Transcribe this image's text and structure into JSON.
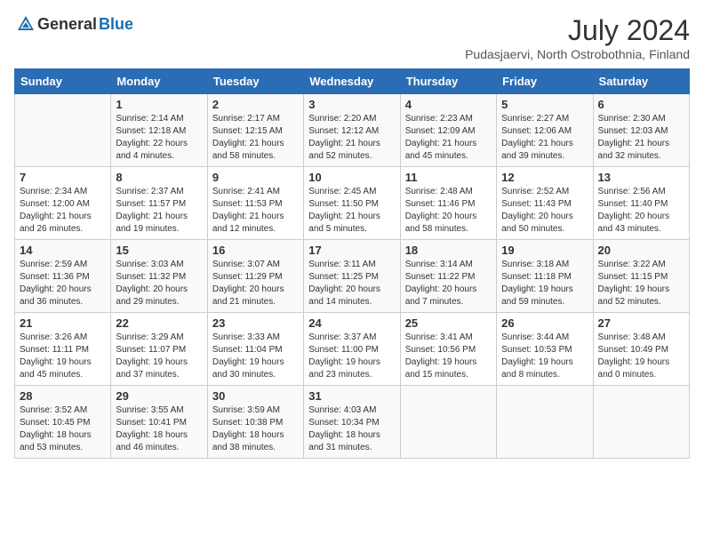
{
  "header": {
    "logo_general": "General",
    "logo_blue": "Blue",
    "month_year": "July 2024",
    "location": "Pudasjaervi, North Ostrobothnia, Finland"
  },
  "days_of_week": [
    "Sunday",
    "Monday",
    "Tuesday",
    "Wednesday",
    "Thursday",
    "Friday",
    "Saturday"
  ],
  "weeks": [
    [
      {
        "day": "",
        "detail": ""
      },
      {
        "day": "1",
        "detail": "Sunrise: 2:14 AM\nSunset: 12:18 AM\nDaylight: 22 hours and 4 minutes."
      },
      {
        "day": "2",
        "detail": "Sunrise: 2:17 AM\nSunset: 12:15 AM\nDaylight: 21 hours and 58 minutes."
      },
      {
        "day": "3",
        "detail": "Sunrise: 2:20 AM\nSunset: 12:12 AM\nDaylight: 21 hours and 52 minutes."
      },
      {
        "day": "4",
        "detail": "Sunrise: 2:23 AM\nSunset: 12:09 AM\nDaylight: 21 hours and 45 minutes."
      },
      {
        "day": "5",
        "detail": "Sunrise: 2:27 AM\nSunset: 12:06 AM\nDaylight: 21 hours and 39 minutes."
      },
      {
        "day": "6",
        "detail": "Sunrise: 2:30 AM\nSunset: 12:03 AM\nDaylight: 21 hours and 32 minutes."
      }
    ],
    [
      {
        "day": "7",
        "detail": "Sunrise: 2:34 AM\nSunset: 12:00 AM\nDaylight: 21 hours and 26 minutes."
      },
      {
        "day": "8",
        "detail": "Sunrise: 2:37 AM\nSunset: 11:57 PM\nDaylight: 21 hours and 19 minutes."
      },
      {
        "day": "9",
        "detail": "Sunrise: 2:41 AM\nSunset: 11:53 PM\nDaylight: 21 hours and 12 minutes."
      },
      {
        "day": "10",
        "detail": "Sunrise: 2:45 AM\nSunset: 11:50 PM\nDaylight: 21 hours and 5 minutes."
      },
      {
        "day": "11",
        "detail": "Sunrise: 2:48 AM\nSunset: 11:46 PM\nDaylight: 20 hours and 58 minutes."
      },
      {
        "day": "12",
        "detail": "Sunrise: 2:52 AM\nSunset: 11:43 PM\nDaylight: 20 hours and 50 minutes."
      },
      {
        "day": "13",
        "detail": "Sunrise: 2:56 AM\nSunset: 11:40 PM\nDaylight: 20 hours and 43 minutes."
      }
    ],
    [
      {
        "day": "14",
        "detail": "Sunrise: 2:59 AM\nSunset: 11:36 PM\nDaylight: 20 hours and 36 minutes."
      },
      {
        "day": "15",
        "detail": "Sunrise: 3:03 AM\nSunset: 11:32 PM\nDaylight: 20 hours and 29 minutes."
      },
      {
        "day": "16",
        "detail": "Sunrise: 3:07 AM\nSunset: 11:29 PM\nDaylight: 20 hours and 21 minutes."
      },
      {
        "day": "17",
        "detail": "Sunrise: 3:11 AM\nSunset: 11:25 PM\nDaylight: 20 hours and 14 minutes."
      },
      {
        "day": "18",
        "detail": "Sunrise: 3:14 AM\nSunset: 11:22 PM\nDaylight: 20 hours and 7 minutes."
      },
      {
        "day": "19",
        "detail": "Sunrise: 3:18 AM\nSunset: 11:18 PM\nDaylight: 19 hours and 59 minutes."
      },
      {
        "day": "20",
        "detail": "Sunrise: 3:22 AM\nSunset: 11:15 PM\nDaylight: 19 hours and 52 minutes."
      }
    ],
    [
      {
        "day": "21",
        "detail": "Sunrise: 3:26 AM\nSunset: 11:11 PM\nDaylight: 19 hours and 45 minutes."
      },
      {
        "day": "22",
        "detail": "Sunrise: 3:29 AM\nSunset: 11:07 PM\nDaylight: 19 hours and 37 minutes."
      },
      {
        "day": "23",
        "detail": "Sunrise: 3:33 AM\nSunset: 11:04 PM\nDaylight: 19 hours and 30 minutes."
      },
      {
        "day": "24",
        "detail": "Sunrise: 3:37 AM\nSunset: 11:00 PM\nDaylight: 19 hours and 23 minutes."
      },
      {
        "day": "25",
        "detail": "Sunrise: 3:41 AM\nSunset: 10:56 PM\nDaylight: 19 hours and 15 minutes."
      },
      {
        "day": "26",
        "detail": "Sunrise: 3:44 AM\nSunset: 10:53 PM\nDaylight: 19 hours and 8 minutes."
      },
      {
        "day": "27",
        "detail": "Sunrise: 3:48 AM\nSunset: 10:49 PM\nDaylight: 19 hours and 0 minutes."
      }
    ],
    [
      {
        "day": "28",
        "detail": "Sunrise: 3:52 AM\nSunset: 10:45 PM\nDaylight: 18 hours and 53 minutes."
      },
      {
        "day": "29",
        "detail": "Sunrise: 3:55 AM\nSunset: 10:41 PM\nDaylight: 18 hours and 46 minutes."
      },
      {
        "day": "30",
        "detail": "Sunrise: 3:59 AM\nSunset: 10:38 PM\nDaylight: 18 hours and 38 minutes."
      },
      {
        "day": "31",
        "detail": "Sunrise: 4:03 AM\nSunset: 10:34 PM\nDaylight: 18 hours and 31 minutes."
      },
      {
        "day": "",
        "detail": ""
      },
      {
        "day": "",
        "detail": ""
      },
      {
        "day": "",
        "detail": ""
      }
    ]
  ]
}
